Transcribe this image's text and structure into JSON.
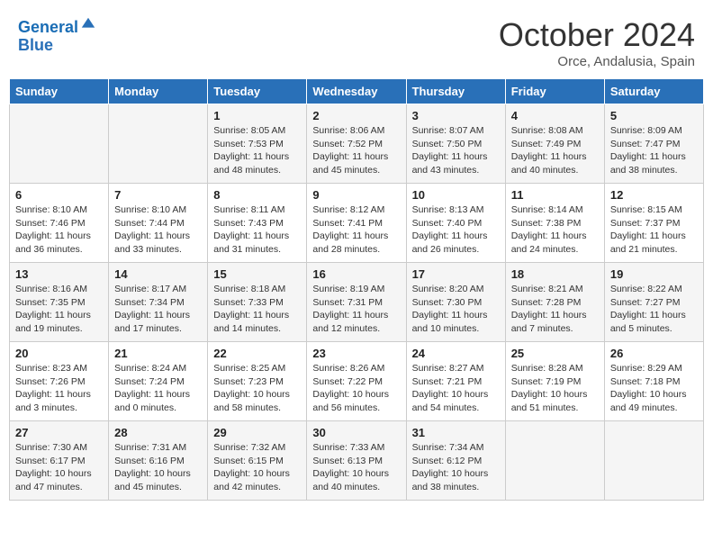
{
  "header": {
    "logo_line1": "General",
    "logo_line2": "Blue",
    "month": "October 2024",
    "location": "Orce, Andalusia, Spain"
  },
  "weekdays": [
    "Sunday",
    "Monday",
    "Tuesday",
    "Wednesday",
    "Thursday",
    "Friday",
    "Saturday"
  ],
  "weeks": [
    [
      {
        "day": "",
        "info": ""
      },
      {
        "day": "",
        "info": ""
      },
      {
        "day": "1",
        "info": "Sunrise: 8:05 AM\nSunset: 7:53 PM\nDaylight: 11 hours and 48 minutes."
      },
      {
        "day": "2",
        "info": "Sunrise: 8:06 AM\nSunset: 7:52 PM\nDaylight: 11 hours and 45 minutes."
      },
      {
        "day": "3",
        "info": "Sunrise: 8:07 AM\nSunset: 7:50 PM\nDaylight: 11 hours and 43 minutes."
      },
      {
        "day": "4",
        "info": "Sunrise: 8:08 AM\nSunset: 7:49 PM\nDaylight: 11 hours and 40 minutes."
      },
      {
        "day": "5",
        "info": "Sunrise: 8:09 AM\nSunset: 7:47 PM\nDaylight: 11 hours and 38 minutes."
      }
    ],
    [
      {
        "day": "6",
        "info": "Sunrise: 8:10 AM\nSunset: 7:46 PM\nDaylight: 11 hours and 36 minutes."
      },
      {
        "day": "7",
        "info": "Sunrise: 8:10 AM\nSunset: 7:44 PM\nDaylight: 11 hours and 33 minutes."
      },
      {
        "day": "8",
        "info": "Sunrise: 8:11 AM\nSunset: 7:43 PM\nDaylight: 11 hours and 31 minutes."
      },
      {
        "day": "9",
        "info": "Sunrise: 8:12 AM\nSunset: 7:41 PM\nDaylight: 11 hours and 28 minutes."
      },
      {
        "day": "10",
        "info": "Sunrise: 8:13 AM\nSunset: 7:40 PM\nDaylight: 11 hours and 26 minutes."
      },
      {
        "day": "11",
        "info": "Sunrise: 8:14 AM\nSunset: 7:38 PM\nDaylight: 11 hours and 24 minutes."
      },
      {
        "day": "12",
        "info": "Sunrise: 8:15 AM\nSunset: 7:37 PM\nDaylight: 11 hours and 21 minutes."
      }
    ],
    [
      {
        "day": "13",
        "info": "Sunrise: 8:16 AM\nSunset: 7:35 PM\nDaylight: 11 hours and 19 minutes."
      },
      {
        "day": "14",
        "info": "Sunrise: 8:17 AM\nSunset: 7:34 PM\nDaylight: 11 hours and 17 minutes."
      },
      {
        "day": "15",
        "info": "Sunrise: 8:18 AM\nSunset: 7:33 PM\nDaylight: 11 hours and 14 minutes."
      },
      {
        "day": "16",
        "info": "Sunrise: 8:19 AM\nSunset: 7:31 PM\nDaylight: 11 hours and 12 minutes."
      },
      {
        "day": "17",
        "info": "Sunrise: 8:20 AM\nSunset: 7:30 PM\nDaylight: 11 hours and 10 minutes."
      },
      {
        "day": "18",
        "info": "Sunrise: 8:21 AM\nSunset: 7:28 PM\nDaylight: 11 hours and 7 minutes."
      },
      {
        "day": "19",
        "info": "Sunrise: 8:22 AM\nSunset: 7:27 PM\nDaylight: 11 hours and 5 minutes."
      }
    ],
    [
      {
        "day": "20",
        "info": "Sunrise: 8:23 AM\nSunset: 7:26 PM\nDaylight: 11 hours and 3 minutes."
      },
      {
        "day": "21",
        "info": "Sunrise: 8:24 AM\nSunset: 7:24 PM\nDaylight: 11 hours and 0 minutes."
      },
      {
        "day": "22",
        "info": "Sunrise: 8:25 AM\nSunset: 7:23 PM\nDaylight: 10 hours and 58 minutes."
      },
      {
        "day": "23",
        "info": "Sunrise: 8:26 AM\nSunset: 7:22 PM\nDaylight: 10 hours and 56 minutes."
      },
      {
        "day": "24",
        "info": "Sunrise: 8:27 AM\nSunset: 7:21 PM\nDaylight: 10 hours and 54 minutes."
      },
      {
        "day": "25",
        "info": "Sunrise: 8:28 AM\nSunset: 7:19 PM\nDaylight: 10 hours and 51 minutes."
      },
      {
        "day": "26",
        "info": "Sunrise: 8:29 AM\nSunset: 7:18 PM\nDaylight: 10 hours and 49 minutes."
      }
    ],
    [
      {
        "day": "27",
        "info": "Sunrise: 7:30 AM\nSunset: 6:17 PM\nDaylight: 10 hours and 47 minutes."
      },
      {
        "day": "28",
        "info": "Sunrise: 7:31 AM\nSunset: 6:16 PM\nDaylight: 10 hours and 45 minutes."
      },
      {
        "day": "29",
        "info": "Sunrise: 7:32 AM\nSunset: 6:15 PM\nDaylight: 10 hours and 42 minutes."
      },
      {
        "day": "30",
        "info": "Sunrise: 7:33 AM\nSunset: 6:13 PM\nDaylight: 10 hours and 40 minutes."
      },
      {
        "day": "31",
        "info": "Sunrise: 7:34 AM\nSunset: 6:12 PM\nDaylight: 10 hours and 38 minutes."
      },
      {
        "day": "",
        "info": ""
      },
      {
        "day": "",
        "info": ""
      }
    ]
  ]
}
